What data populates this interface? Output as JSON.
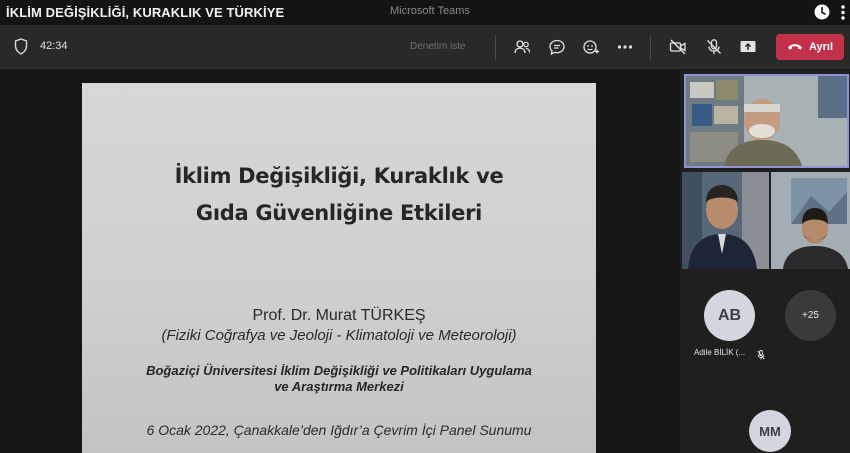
{
  "titlebar": {
    "video_title": "İKLİM DEĞİŞİKLİĞİ, KURAKLIK VE TÜRKİYE",
    "app_title": "Microsoft Teams"
  },
  "toolbar": {
    "timer": "42:34",
    "dim_label": "Denetim iste",
    "leave_label": "Ayrıl",
    "leave_color": "#c4314b"
  },
  "slide": {
    "title_line1": "İklim Değişikliği, Kuraklık ve",
    "title_line2": "Gıda Güvenliğine Etkileri",
    "author": "Prof. Dr. Murat TÜRKEŞ",
    "department": "(Fiziki Coğrafya ve Jeoloji - Klimatoloji ve Meteoroloji)",
    "institution_line1": "Boğaziçi Üniversitesi İklim Değişikliği ve Politikaları Uygulama",
    "institution_line2": "ve Araştırma Merkezi",
    "event": "6 Ocak 2022, Çanakkale’den Iğdır’a Çevrim İçi Panel Sunumu"
  },
  "gallery": {
    "active_speaker_border": "#8f92d6",
    "avatar_ab_initials": "AB",
    "avatar_ab_name": "Adile BİLİK (...",
    "more_count": "+25",
    "avatar_mm_initials": "MM"
  }
}
